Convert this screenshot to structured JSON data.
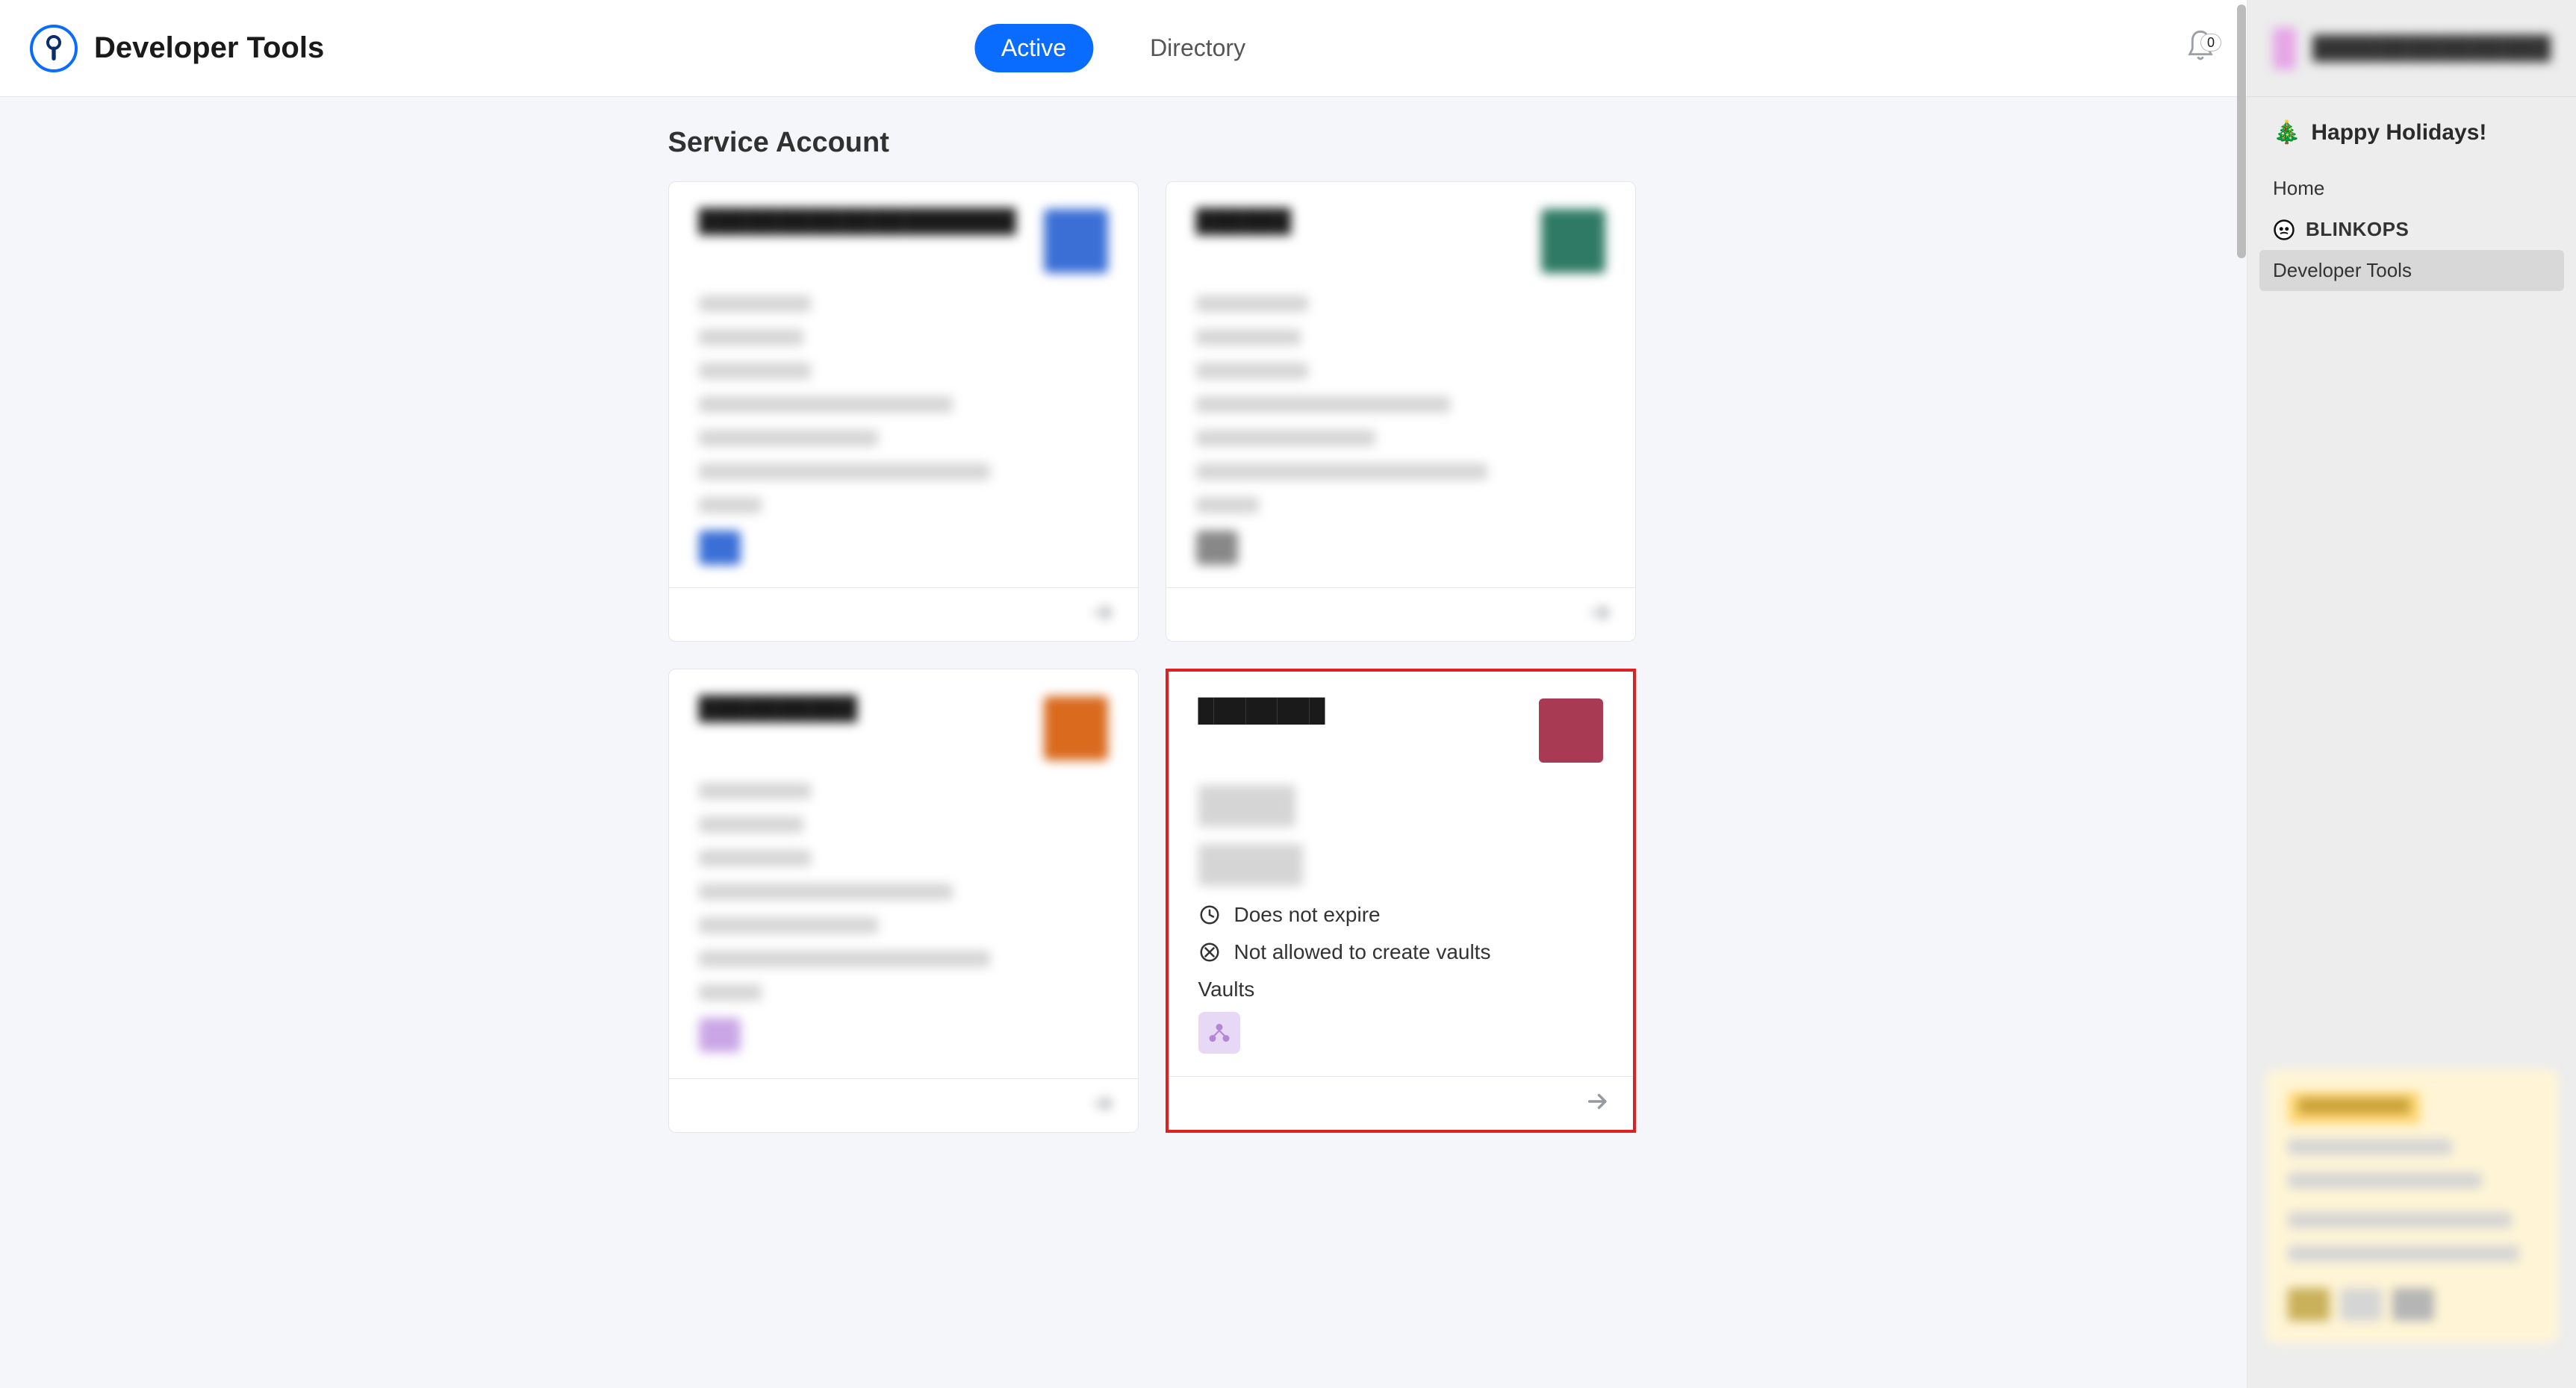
{
  "header": {
    "title": "Developer Tools",
    "tabs": {
      "active": "Active",
      "directory": "Directory"
    },
    "notifications_count": "0"
  },
  "section": {
    "title": "Service Account"
  },
  "cards": [
    {
      "name": "████████████████████",
      "avatar_color": "#3b6fd6",
      "highlight": false,
      "expire_label": "",
      "vault_perm_label": "",
      "vaults_label": "",
      "vault_icon_color": "#3b6fd6",
      "blurred": true
    },
    {
      "name": "██████",
      "avatar_color": "#2f7a64",
      "highlight": false,
      "expire_label": "",
      "vault_perm_label": "",
      "vaults_label": "",
      "vault_icon_color": "#888",
      "blurred": true
    },
    {
      "name": "██████████",
      "avatar_color": "#d96a1e",
      "highlight": false,
      "expire_label": "",
      "vault_perm_label": "",
      "vaults_label": "",
      "vault_icon_color": "#caa6e6",
      "blurred": true
    },
    {
      "name": "████████",
      "avatar_color": "#a93a54",
      "highlight": true,
      "expire_label": "Does not expire",
      "vault_perm_label": "Not allowed to create vaults",
      "vaults_label": "Vaults",
      "vault_icon_color": "#b585d6",
      "blurred": false
    }
  ],
  "sidebar": {
    "user_name": "███████████████",
    "holidays": "Happy Holidays!",
    "nav": {
      "home": "Home",
      "org": "BLINKOPS",
      "dev_tools": "Developer Tools"
    },
    "promo": {
      "tag": "████████████"
    }
  }
}
